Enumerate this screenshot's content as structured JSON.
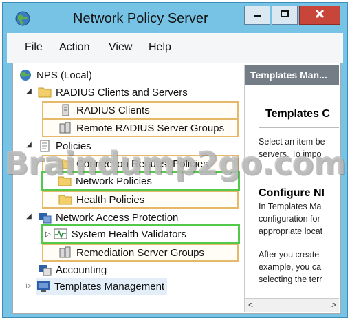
{
  "window": {
    "title": "Network Policy Server",
    "icon": "nps-globe-icon"
  },
  "menu": [
    "File",
    "Action",
    "View",
    "Help"
  ],
  "tree": {
    "root": "NPS (Local)",
    "radius_group": "RADIUS Clients and Servers",
    "radius_clients": "RADIUS Clients",
    "remote_radius": "Remote RADIUS Server Groups",
    "policies": "Policies",
    "connection_request": "Connection Request Policies",
    "network_policies": "Network Policies",
    "health_policies": "Health Policies",
    "nap": "Network Access Protection",
    "shv": "System Health Validators",
    "remediation": "Remediation Server Groups",
    "accounting": "Accounting",
    "templates": "Templates Management"
  },
  "right_pane": {
    "header": "Templates Man...",
    "heading": "Templates C",
    "line1": "Select an item be",
    "line2": "servers. To impo",
    "subheading": "Configure NI",
    "p1": "In Templates Ma",
    "p2": "configuration for",
    "p3": "appropriate locat",
    "p4": "After you create",
    "p5": "example, you ca",
    "p6": "selecting the terr"
  },
  "watermark": "Braindump2go.com",
  "colors": {
    "titlebar": "#77c3e6",
    "close_button": "#c8453a",
    "highlight_orange": "#e6b96a",
    "highlight_green": "#52c94a",
    "right_header": "#747d86"
  }
}
